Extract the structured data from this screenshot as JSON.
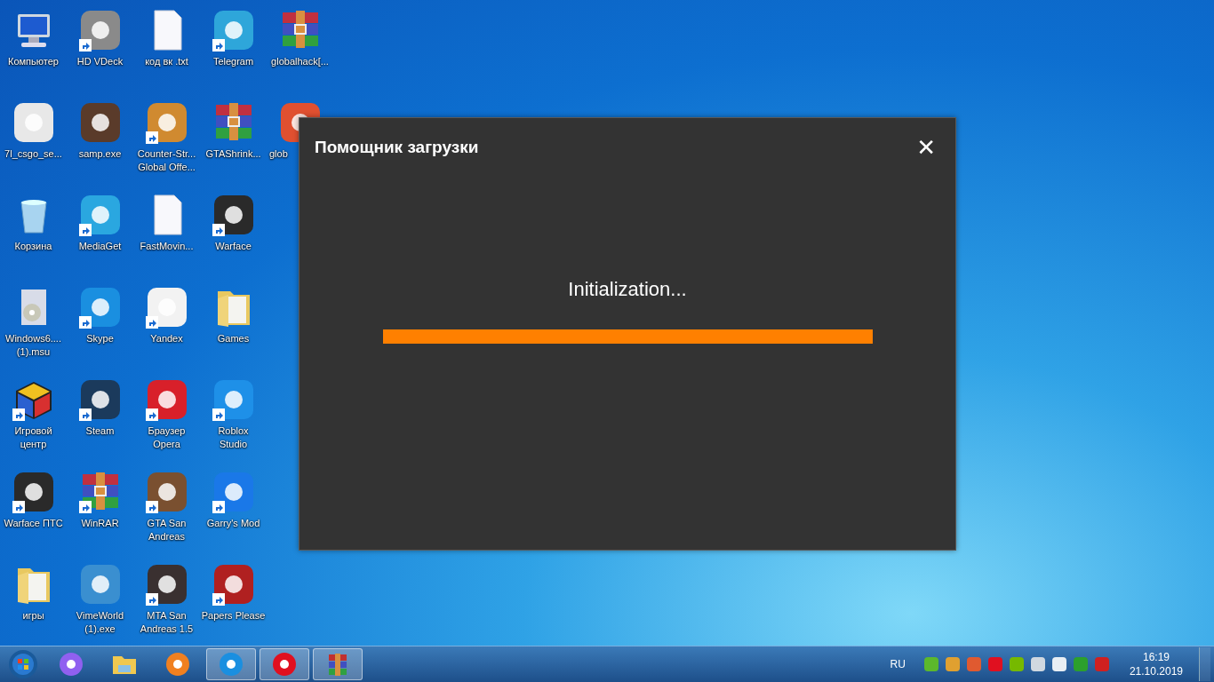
{
  "desktop_icons": [
    {
      "label": "Компьютер",
      "kind": "computer",
      "shortcut": false
    },
    {
      "label": "7l_csgo_se...",
      "kind": "app",
      "color": "#e8e8e8",
      "shortcut": false
    },
    {
      "label": "Корзина",
      "kind": "recycle-bin",
      "shortcut": false
    },
    {
      "label": "Windows6....\n(1).msu",
      "kind": "installer",
      "shortcut": false
    },
    {
      "label": "Игровой\nцентр",
      "kind": "cube",
      "shortcut": true
    },
    {
      "label": "Warface ПТС",
      "kind": "app",
      "color": "#2a2a2a",
      "shortcut": true
    },
    {
      "label": "игры",
      "kind": "folder",
      "shortcut": false
    },
    {
      "label": "HD VDeck",
      "kind": "app",
      "color": "#8a8a8a",
      "shortcut": true
    },
    {
      "label": "samp.exe",
      "kind": "app",
      "color": "#5a3b2a",
      "shortcut": false
    },
    {
      "label": "MediaGet",
      "kind": "app",
      "color": "#2aa7e0",
      "shortcut": true
    },
    {
      "label": "Skype",
      "kind": "app",
      "color": "#1a8fe0",
      "shortcut": true
    },
    {
      "label": "Steam",
      "kind": "app",
      "color": "#1b3a5c",
      "shortcut": true
    },
    {
      "label": "WinRAR",
      "kind": "archive",
      "shortcut": true
    },
    {
      "label": "VimeWorld\n(1).exe",
      "kind": "app",
      "color": "#3a8fd0",
      "shortcut": false
    },
    {
      "label": "код вк .txt",
      "kind": "document",
      "shortcut": false
    },
    {
      "label": "Counter-Str...\nGlobal Offe...",
      "kind": "app",
      "color": "#d08a30",
      "shortcut": true
    },
    {
      "label": "FastMovin...",
      "kind": "document",
      "shortcut": false
    },
    {
      "label": "Yandex",
      "kind": "app",
      "color": "#f2f2f2",
      "shortcut": true
    },
    {
      "label": "Браузер\nOpera",
      "kind": "app",
      "color": "#d8202a",
      "shortcut": true
    },
    {
      "label": "GTA San\nAndreas",
      "kind": "app",
      "color": "#7a5030",
      "shortcut": true
    },
    {
      "label": "MTA San\nAndreas 1.5",
      "kind": "app",
      "color": "#3a3030",
      "shortcut": true
    },
    {
      "label": "Telegram",
      "kind": "app",
      "color": "#2ea6da",
      "shortcut": true
    },
    {
      "label": "GTAShrink...",
      "kind": "archive",
      "shortcut": false
    },
    {
      "label": "Warface",
      "kind": "app",
      "color": "#2a2a2a",
      "shortcut": true
    },
    {
      "label": "Games",
      "kind": "folder",
      "shortcut": false
    },
    {
      "label": "Roblox\nStudio",
      "kind": "app",
      "color": "#1e90e8",
      "shortcut": true
    },
    {
      "label": "Garry's Mod",
      "kind": "app",
      "color": "#1a78e8",
      "shortcut": true
    },
    {
      "label": "Papers Please",
      "kind": "app",
      "color": "#b02020",
      "shortcut": true
    },
    {
      "label": "globalhack[...",
      "kind": "archive",
      "shortcut": false
    },
    {
      "label": "glob",
      "kind": "app",
      "color": "#e05030",
      "shortcut": false
    }
  ],
  "dialog": {
    "title": "Помощник загрузки",
    "close": "✕",
    "status": "Initialization...",
    "progress": {
      "level": 1
    }
  },
  "taskbar": {
    "items": [
      {
        "kind": "start",
        "running": false,
        "color": "#2a7ad0"
      },
      {
        "kind": "app",
        "running": false,
        "color": "#9060f0"
      },
      {
        "kind": "folder",
        "running": false,
        "color": "#f0c850"
      },
      {
        "kind": "app",
        "running": false,
        "color": "#f08020"
      },
      {
        "kind": "app",
        "running": true,
        "color": "#1a8fe0"
      },
      {
        "kind": "app",
        "running": true,
        "color": "#e01020"
      },
      {
        "kind": "archive",
        "running": true
      }
    ],
    "language": "RU",
    "tray": [
      {
        "color": "#5cb82c"
      },
      {
        "color": "#e0a030"
      },
      {
        "color": "#e05a30"
      },
      {
        "color": "#e01020"
      },
      {
        "color": "#76b900"
      },
      {
        "color": "#d0d8e0"
      },
      {
        "color": "#e8eef4"
      },
      {
        "color": "#2ca02c"
      },
      {
        "color": "#d02020"
      }
    ],
    "time": "16:19",
    "date": "21.10.2019"
  }
}
